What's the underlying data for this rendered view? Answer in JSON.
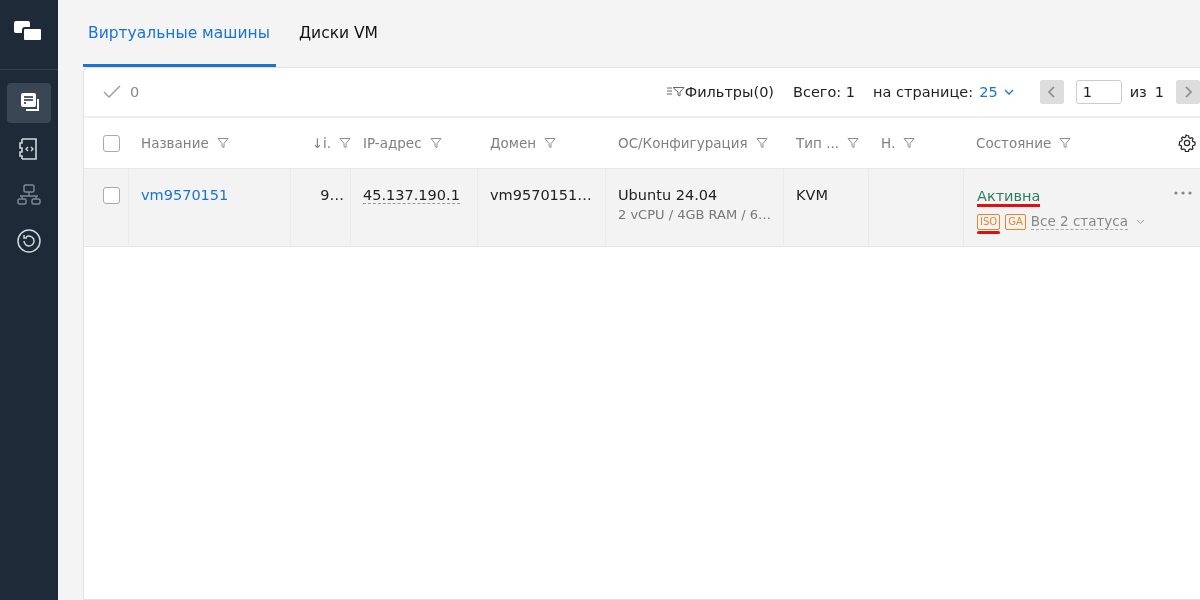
{
  "sidebar": {
    "items": [
      {
        "selected": true
      },
      {
        "selected": false
      },
      {
        "selected": false
      },
      {
        "selected": false
      }
    ]
  },
  "tabs": [
    {
      "label": "Виртуальные машины",
      "selected": true
    },
    {
      "label": "Диски VM",
      "selected": false
    }
  ],
  "toolbar": {
    "selected_count": "0",
    "filters": "Фильтры(0)",
    "total": "Всего: 1",
    "per_page_label": "на странице:",
    "per_page": "25",
    "page": "1",
    "of": "из",
    "pages": "1"
  },
  "table": {
    "header_checked": false,
    "columns": [
      {
        "label": "Название"
      },
      {
        "label": "↓i."
      },
      {
        "label": "IP-адрес"
      },
      {
        "label": "Домен"
      },
      {
        "label": "ОС/Конфигурация"
      },
      {
        "label": "Тип ..."
      },
      {
        "label": "Н."
      },
      {
        "label": "Состояние"
      }
    ],
    "rows": [
      {
        "checked": false,
        "name": "vm9570151",
        "id": "9…",
        "ip": "45.137.190.1",
        "domain": "vm9570151…",
        "os": "Ubuntu 24.04",
        "config": "2 vCPU / 4GB RAM / 6…",
        "type": "KVM",
        "state": "Активна",
        "state_underlined": true,
        "badges": [
          {
            "label": "ISO",
            "underlined": true
          },
          {
            "label": "GA",
            "underlined": false
          }
        ],
        "statuses": "Все 2 статуса"
      }
    ]
  }
}
